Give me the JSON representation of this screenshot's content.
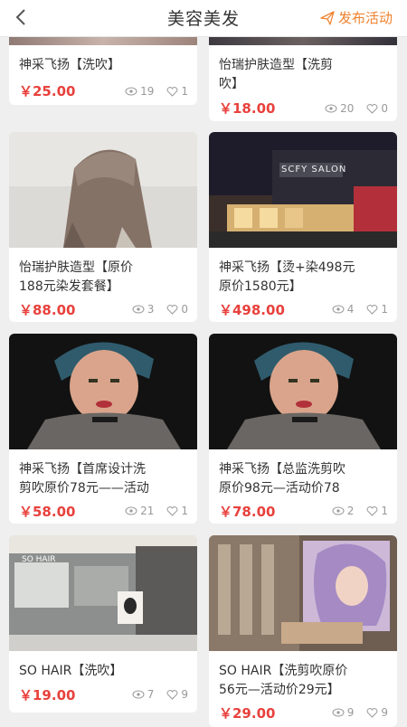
{
  "header": {
    "title": "美容美发",
    "publish_label": "发布活动",
    "accent": "#f0832f"
  },
  "items": [
    {
      "title": "神采飞扬【洗吹】",
      "price": "￥25.00",
      "views": "19",
      "likes": "1"
    },
    {
      "title": "怡瑞护肤造型【洗剪\n吹】",
      "price": "￥18.00",
      "views": "20",
      "likes": "0"
    },
    {
      "title": "怡瑞护肤造型【原价\n188元染发套餐】",
      "price": "￥88.00",
      "views": "3",
      "likes": "0"
    },
    {
      "title": "神采飞扬【烫+染498元\n原价1580元】",
      "price": "￥498.00",
      "views": "4",
      "likes": "1",
      "img_sign": "SCFY SALON"
    },
    {
      "title": "神采飞扬【首席设计洗\n剪吹原价78元——活动",
      "price": "￥58.00",
      "views": "21",
      "likes": "1"
    },
    {
      "title": "神采飞扬【总监洗剪吹\n原价98元—活动价78",
      "price": "￥78.00",
      "views": "2",
      "likes": "1"
    },
    {
      "title": "SO HAIR【洗吹】",
      "price": "￥19.00",
      "views": "7",
      "likes": "9",
      "img_sign": "SO HAIR"
    },
    {
      "title": "SO HAIR【洗剪吹原价\n56元—活动价29元】",
      "price": "￥29.00",
      "views": "9",
      "likes": "9"
    }
  ],
  "colors": {
    "price": "#e8413c",
    "background": "#efefef"
  }
}
